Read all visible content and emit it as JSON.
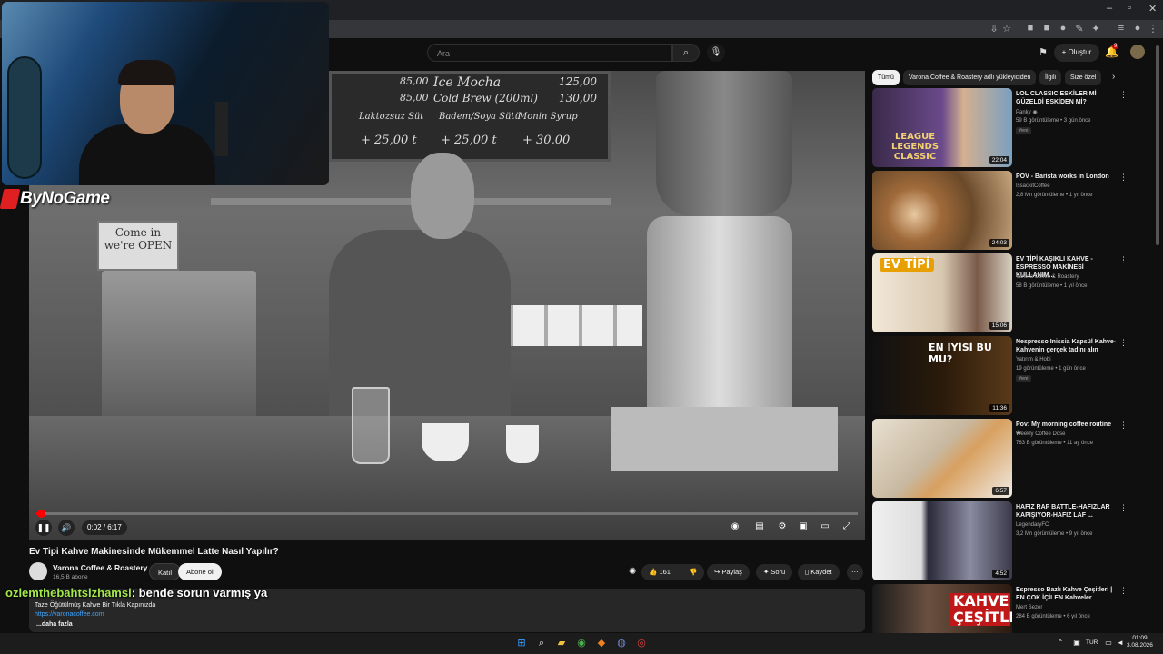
{
  "masthead": {
    "search_placeholder": "Ara",
    "create_label": "+ Oluştur",
    "notif_count": "9"
  },
  "player": {
    "menu_items": [
      "Ice Mocha",
      "Cold Brew (200ml)",
      "Laktozsuz Süt",
      "Badem/Soya Sütü",
      "Monin Syrup"
    ],
    "menu_prices": [
      "125,00",
      "130,00"
    ],
    "menu_prices_side": [
      "85,00",
      "85,00"
    ],
    "menu_extras": [
      "+ 25,00 t",
      "+ 25,00 t",
      "+ 30,00"
    ],
    "sign_text": "Come in we're OPEN",
    "time": "0:02 / 6:17",
    "progress": 0.005
  },
  "overlay": {
    "logo_text": "ByNoGame",
    "chat_user": "ozlemthebahtsizhamsi",
    "chat_message": ": bende sorun varmış ya"
  },
  "video": {
    "title": "Ev Tipi Kahve Makinesinde Mükemmel Latte Nasıl Yapılır?",
    "channel": "Varona Coffee & Roastery",
    "subscribers": "16,5 B abone",
    "join": "Katıl",
    "subscribe": "Abone ol",
    "likes": "161",
    "share": "Paylaş",
    "ask": "Soru",
    "save": "Kaydet",
    "description_line": "Taze Öğütülmüş Kahve Bir Tıkla Kapınızda",
    "description_link": "https://varonacoffee.com",
    "description_more": "...daha fazla"
  },
  "sidebar": {
    "chips": [
      "Tümü",
      "Varona Coffee & Roastery adlı yükleyiciden",
      "İlgili",
      "Size özel"
    ],
    "recommendations": [
      {
        "title": "LOL CLASSIC ESKİLER Mİ GÜZELDİ ESKİDEN Mİ?",
        "channel": "Panky ◉",
        "meta": "59 B görüntüleme • 3 gün önce",
        "badge": "Yeni",
        "duration": "22:04",
        "thumb_text": "LEAGUE LEGENDS CLASSIC"
      },
      {
        "title": "POV - Barista works in London",
        "channel": "IssackitCoffee",
        "meta": "2,8 Mn görüntüleme • 1 yıl önce",
        "badge": "",
        "duration": "24:03",
        "thumb_text": ""
      },
      {
        "title": "EV TİPİ KAŞIKLI KAHVE - ESPRESSO MAKİNESİ KULLANIM...",
        "channel": "Varona Coffee & Roastery",
        "meta": "58 B görüntüleme • 1 yıl önce",
        "badge": "",
        "duration": "15:06",
        "thumb_text": "EV TİPİ"
      },
      {
        "title": "Nespresso Inissia Kapsül Kahve- Kahvenin gerçek tadını alın",
        "channel": "Yatırım & Hobi",
        "meta": "19 görüntüleme • 1 gün önce",
        "badge": "Yeni",
        "duration": "11:36",
        "thumb_text": "EN İYİSİ BU MU?"
      },
      {
        "title": "Pov: My morning coffee routine ☕",
        "channel": "Weekly Coffee Dose",
        "meta": "763 B görüntüleme • 11 ay önce",
        "badge": "",
        "duration": "6:57",
        "thumb_text": ""
      },
      {
        "title": "HAFIZ RAP BATTLE-HAFIZLAR KAPIŞIYOR-HAFIZ LAF ...",
        "channel": "LegendaryFC",
        "meta": "3,2 Mn görüntüleme • 9 yıl önce",
        "badge": "",
        "duration": "4:52",
        "thumb_text": ""
      },
      {
        "title": "Espresso Bazlı Kahve Çeşitleri | EN ÇOK İÇİLEN Kahveler",
        "channel": "Mert Sezer",
        "meta": "284 B görüntüleme • 6 yıl önce",
        "badge": "",
        "duration": "",
        "thumb_text": "KAHVE ÇEŞİTLERİ"
      }
    ]
  },
  "taskbar": {
    "lang": "TUR",
    "time": "01:09",
    "date": "3.08.2026"
  },
  "colors": {
    "accent_red": "#ff0000",
    "link_blue": "#3ea6ff",
    "chat_green": "#a5e94a"
  }
}
